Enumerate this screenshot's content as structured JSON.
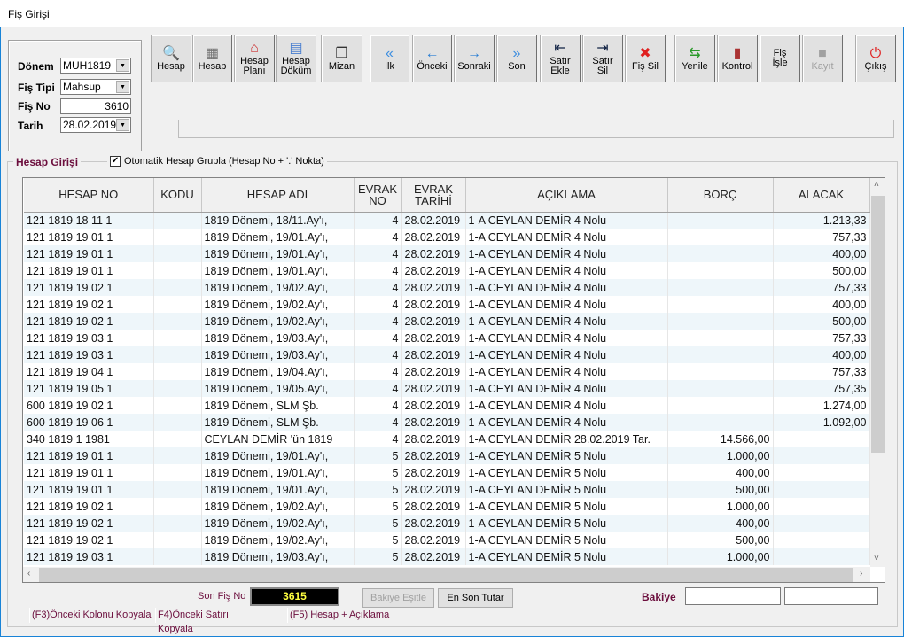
{
  "window": {
    "title": "Fiş Girişi"
  },
  "form": {
    "donem_label": "Dönem",
    "donem_value": "MUH1819",
    "fis_tipi_label": "Fiş Tipi",
    "fis_tipi_value": "Mahsup",
    "fis_no_label": "Fiş No",
    "fis_no_value": "3610",
    "tarih_label": "Tarih",
    "tarih_value": "28.02.2019"
  },
  "toolbar": [
    {
      "id": "hesap-search",
      "l1": "Hesap",
      "l2": "",
      "icon": "magnifier-icon"
    },
    {
      "id": "hesap-calc",
      "l1": "Hesap",
      "l2": "",
      "icon": "calculator-icon"
    },
    {
      "id": "hesap-plani",
      "l1": "Hesap",
      "l2": "Planı",
      "icon": "account-plan-icon"
    },
    {
      "id": "hesap-dokum",
      "l1": "Hesap",
      "l2": "Döküm",
      "icon": "calendar-icon"
    },
    {
      "id": "mizan",
      "l1": "Mizan",
      "l2": "",
      "icon": "documents-icon"
    },
    {
      "id": "ilk",
      "l1": "İlk",
      "l2": "",
      "icon": "first-icon"
    },
    {
      "id": "onceki",
      "l1": "Önceki",
      "l2": "",
      "icon": "previous-icon"
    },
    {
      "id": "sonraki",
      "l1": "Sonraki",
      "l2": "",
      "icon": "next-icon"
    },
    {
      "id": "son",
      "l1": "Son",
      "l2": "",
      "icon": "last-icon"
    },
    {
      "id": "satir-ekle",
      "l1": "Satır",
      "l2": "Ekle",
      "icon": "insert-row-icon"
    },
    {
      "id": "satir-sil",
      "l1": "Satır",
      "l2": "Sil",
      "icon": "delete-row-icon"
    },
    {
      "id": "fis-sil",
      "l1": "Fiş Sil",
      "l2": "",
      "icon": "red-x-icon"
    },
    {
      "id": "yenile",
      "l1": "Yenile",
      "l2": "",
      "icon": "refresh-icon"
    },
    {
      "id": "kontrol",
      "l1": "Kontrol",
      "l2": "",
      "icon": "books-icon"
    },
    {
      "id": "fis-isle",
      "l1": "Fiş",
      "l2": "İşle",
      "icon": ""
    },
    {
      "id": "kayit",
      "l1": "Kayıt",
      "l2": "",
      "icon": "save-icon",
      "disabled": true
    },
    {
      "id": "cikis",
      "l1": "Çıkış",
      "l2": "",
      "icon": "power-icon"
    }
  ],
  "group": {
    "title": "Hesap Girişi",
    "checkbox_label": "Otomatik Hesap Grupla (Hesap No + '.' Nokta)",
    "checked": true
  },
  "grid": {
    "columns": [
      "HESAP NO",
      "KODU",
      "HESAP ADI",
      "EVRAK NO",
      "EVRAK TARİHİ",
      "AÇIKLAMA",
      "BORÇ",
      "ALACAK"
    ],
    "rows": [
      [
        "121 1819 18 11 1",
        "",
        "1819 Dönemi, 18/11.Ay'ı,",
        "4",
        "28.02.2019",
        "1-A CEYLAN DEMİR 4 Nolu",
        "",
        "1.213,33"
      ],
      [
        "121 1819 19 01 1",
        "",
        "1819 Dönemi, 19/01.Ay'ı,",
        "4",
        "28.02.2019",
        "1-A CEYLAN DEMİR 4 Nolu",
        "",
        "757,33"
      ],
      [
        "121 1819 19 01 1",
        "",
        "1819 Dönemi, 19/01.Ay'ı,",
        "4",
        "28.02.2019",
        "1-A CEYLAN DEMİR 4 Nolu",
        "",
        "400,00"
      ],
      [
        "121 1819 19 01 1",
        "",
        "1819 Dönemi, 19/01.Ay'ı,",
        "4",
        "28.02.2019",
        "1-A CEYLAN DEMİR 4 Nolu",
        "",
        "500,00"
      ],
      [
        "121 1819 19 02 1",
        "",
        "1819 Dönemi, 19/02.Ay'ı,",
        "4",
        "28.02.2019",
        "1-A CEYLAN DEMİR 4 Nolu",
        "",
        "757,33"
      ],
      [
        "121 1819 19 02 1",
        "",
        "1819 Dönemi, 19/02.Ay'ı,",
        "4",
        "28.02.2019",
        "1-A CEYLAN DEMİR 4 Nolu",
        "",
        "400,00"
      ],
      [
        "121 1819 19 02 1",
        "",
        "1819 Dönemi, 19/02.Ay'ı,",
        "4",
        "28.02.2019",
        "1-A CEYLAN DEMİR 4 Nolu",
        "",
        "500,00"
      ],
      [
        "121 1819 19 03 1",
        "",
        "1819 Dönemi, 19/03.Ay'ı,",
        "4",
        "28.02.2019",
        "1-A CEYLAN DEMİR 4 Nolu",
        "",
        "757,33"
      ],
      [
        "121 1819 19 03 1",
        "",
        "1819 Dönemi, 19/03.Ay'ı,",
        "4",
        "28.02.2019",
        "1-A CEYLAN DEMİR 4 Nolu",
        "",
        "400,00"
      ],
      [
        "121 1819 19 04 1",
        "",
        "1819 Dönemi, 19/04.Ay'ı,",
        "4",
        "28.02.2019",
        "1-A CEYLAN DEMİR 4 Nolu",
        "",
        "757,33"
      ],
      [
        "121 1819 19 05 1",
        "",
        "1819 Dönemi, 19/05.Ay'ı,",
        "4",
        "28.02.2019",
        "1-A CEYLAN DEMİR 4 Nolu",
        "",
        "757,35"
      ],
      [
        "600 1819 19 02 1",
        "",
        "1819 Dönemi, SLM Şb.",
        "4",
        "28.02.2019",
        "1-A CEYLAN DEMİR 4 Nolu",
        "",
        "1.274,00"
      ],
      [
        "600 1819 19 06 1",
        "",
        "1819 Dönemi, SLM Şb.",
        "4",
        "28.02.2019",
        "1-A CEYLAN DEMİR 4 Nolu",
        "",
        "1.092,00"
      ],
      [
        "340 1819 1 1981",
        "",
        "CEYLAN DEMİR 'ün 1819",
        "4",
        "28.02.2019",
        "1-A CEYLAN DEMİR 28.02.2019 Tar.",
        "14.566,00",
        ""
      ],
      [
        "121 1819 19 01 1",
        "",
        "1819 Dönemi, 19/01.Ay'ı,",
        "5",
        "28.02.2019",
        "1-A CEYLAN DEMİR 5 Nolu",
        "1.000,00",
        ""
      ],
      [
        "121 1819 19 01 1",
        "",
        "1819 Dönemi, 19/01.Ay'ı,",
        "5",
        "28.02.2019",
        "1-A CEYLAN DEMİR 5 Nolu",
        "400,00",
        ""
      ],
      [
        "121 1819 19 01 1",
        "",
        "1819 Dönemi, 19/01.Ay'ı,",
        "5",
        "28.02.2019",
        "1-A CEYLAN DEMİR 5 Nolu",
        "500,00",
        ""
      ],
      [
        "121 1819 19 02 1",
        "",
        "1819 Dönemi, 19/02.Ay'ı,",
        "5",
        "28.02.2019",
        "1-A CEYLAN DEMİR 5 Nolu",
        "1.000,00",
        ""
      ],
      [
        "121 1819 19 02 1",
        "",
        "1819 Dönemi, 19/02.Ay'ı,",
        "5",
        "28.02.2019",
        "1-A CEYLAN DEMİR 5 Nolu",
        "400,00",
        ""
      ],
      [
        "121 1819 19 02 1",
        "",
        "1819 Dönemi, 19/02.Ay'ı,",
        "5",
        "28.02.2019",
        "1-A CEYLAN DEMİR 5 Nolu",
        "500,00",
        ""
      ],
      [
        "121 1819 19 03 1",
        "",
        "1819 Dönemi, 19/03.Ay'ı,",
        "5",
        "28.02.2019",
        "1-A CEYLAN DEMİR 5 Nolu",
        "1.000,00",
        ""
      ]
    ]
  },
  "footer": {
    "son_fis_no_label": "Son Fiş No",
    "son_fis_no_value": "3615",
    "bakiye_esitle": "Bakiye Eşitle",
    "en_son_tutar": "En Son Tutar",
    "bakiye_label": "Bakiye",
    "bakiye_value1": "",
    "bakiye_value2": "",
    "hints": [
      "(F3)Önceki Kolonu Kopyala",
      "F4)Önceki Satırı Kopyala",
      "(F5) Hesap + Açıklama"
    ]
  }
}
